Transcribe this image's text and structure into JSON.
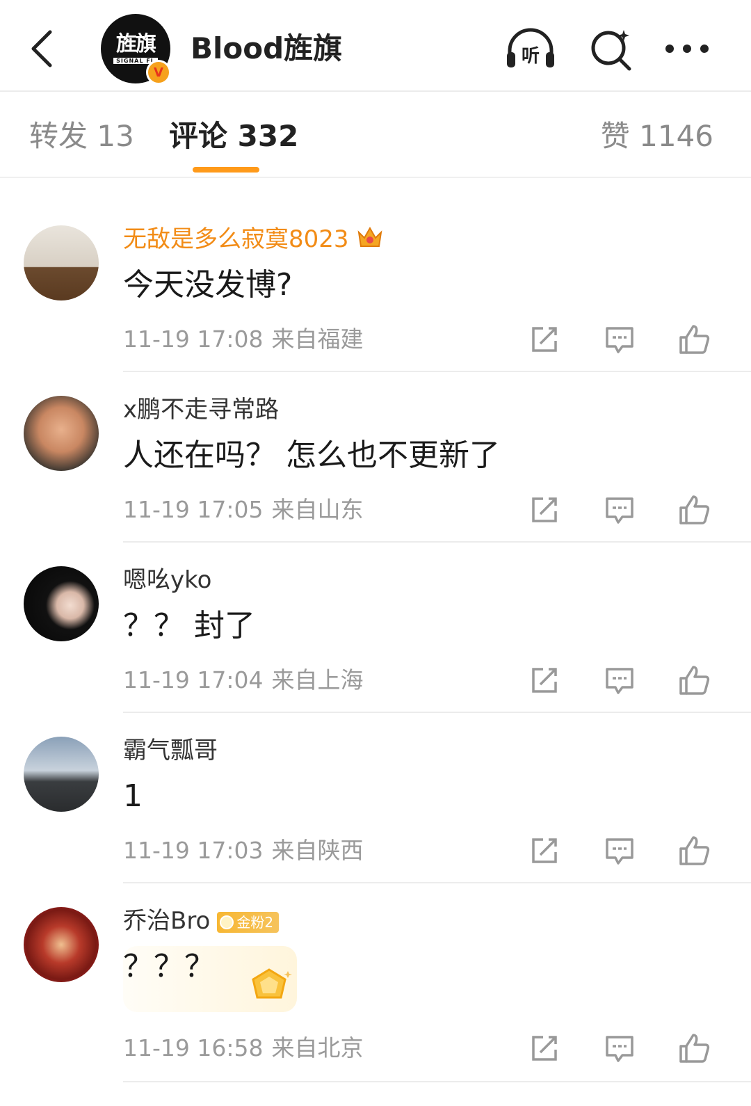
{
  "header": {
    "account_name": "Blood旌旗",
    "logo_text": "旌旗",
    "logo_subtext": "SIGNAL FL",
    "verified_mark": "V",
    "icons": [
      "back-icon",
      "headphones-icon",
      "search-icon",
      "more-icon"
    ],
    "listen_label": "听"
  },
  "tabs": {
    "repost": "转发 13",
    "comment": "评论 332",
    "like": "赞 1146"
  },
  "colors": {
    "accent": "#ff9a1a",
    "vip_name": "#f28c17",
    "meta_text": "#9a9a9a"
  },
  "comments": [
    {
      "username": "无敌是多么寂寞8023",
      "text": "今天没发博?",
      "time": "11-19 17:08",
      "location": "来自福建",
      "vip": true,
      "badge": "crown"
    },
    {
      "username": "x鹏不走寻常路",
      "text": "人还在吗？ 怎么也不更新了",
      "time": "11-19 17:05",
      "location": "来自山东"
    },
    {
      "username": "嗯吆yko",
      "text": "？？ 封了",
      "time": "11-19 17:04",
      "location": "来自上海"
    },
    {
      "username": "霸气瓢哥",
      "text": "1",
      "time": "11-19 17:03",
      "location": "来自陕西"
    },
    {
      "username": "乔治Bro",
      "text": "？？？",
      "time": "11-19 16:58",
      "location": "来自北京",
      "fan_badge": "金粉2"
    }
  ]
}
